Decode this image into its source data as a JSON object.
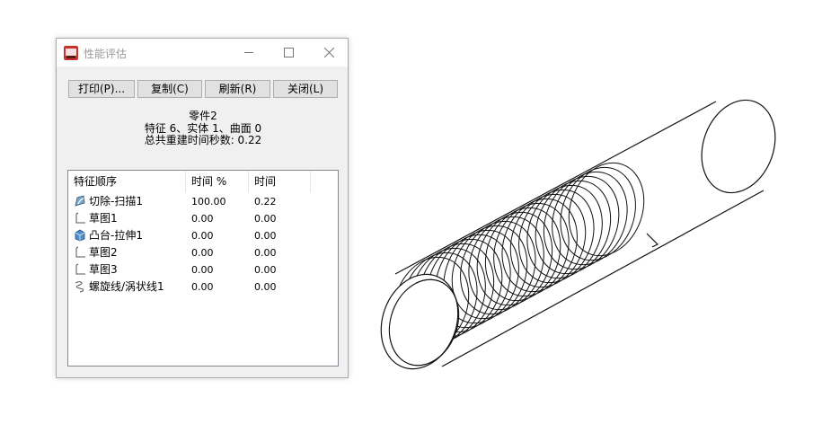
{
  "dialog": {
    "title": "性能评估",
    "buttons": {
      "print": "打印(P)...",
      "copy": "复制(C)",
      "refresh": "刷新(R)",
      "close": "关闭(L)"
    },
    "summary": {
      "part_name": "零件2",
      "counts": "特征 6、实体 1、曲面 0",
      "rebuild_time": "总共重建时间秒数: 0.22"
    },
    "table": {
      "headers": [
        "特征顺序",
        "时间 %",
        "时间"
      ],
      "rows": [
        {
          "icon": "cut-sweep-icon",
          "name": "切除-扫描1",
          "percent": "100.00",
          "time": "0.22"
        },
        {
          "icon": "sketch-icon",
          "name": "草图1",
          "percent": "0.00",
          "time": "0.00"
        },
        {
          "icon": "boss-extrude-icon",
          "name": "凸台-拉伸1",
          "percent": "0.00",
          "time": "0.00"
        },
        {
          "icon": "sketch-icon",
          "name": "草图2",
          "percent": "0.00",
          "time": "0.00"
        },
        {
          "icon": "sketch-icon",
          "name": "草图3",
          "percent": "0.00",
          "time": "0.00"
        },
        {
          "icon": "helix-icon",
          "name": "螺旋线/涡状线1",
          "percent": "0.00",
          "time": "0.00"
        }
      ]
    }
  },
  "colors": {
    "dialog_bg": "#f0f0f0",
    "title_text": "#9a9a9a",
    "model_line": "#111111"
  }
}
